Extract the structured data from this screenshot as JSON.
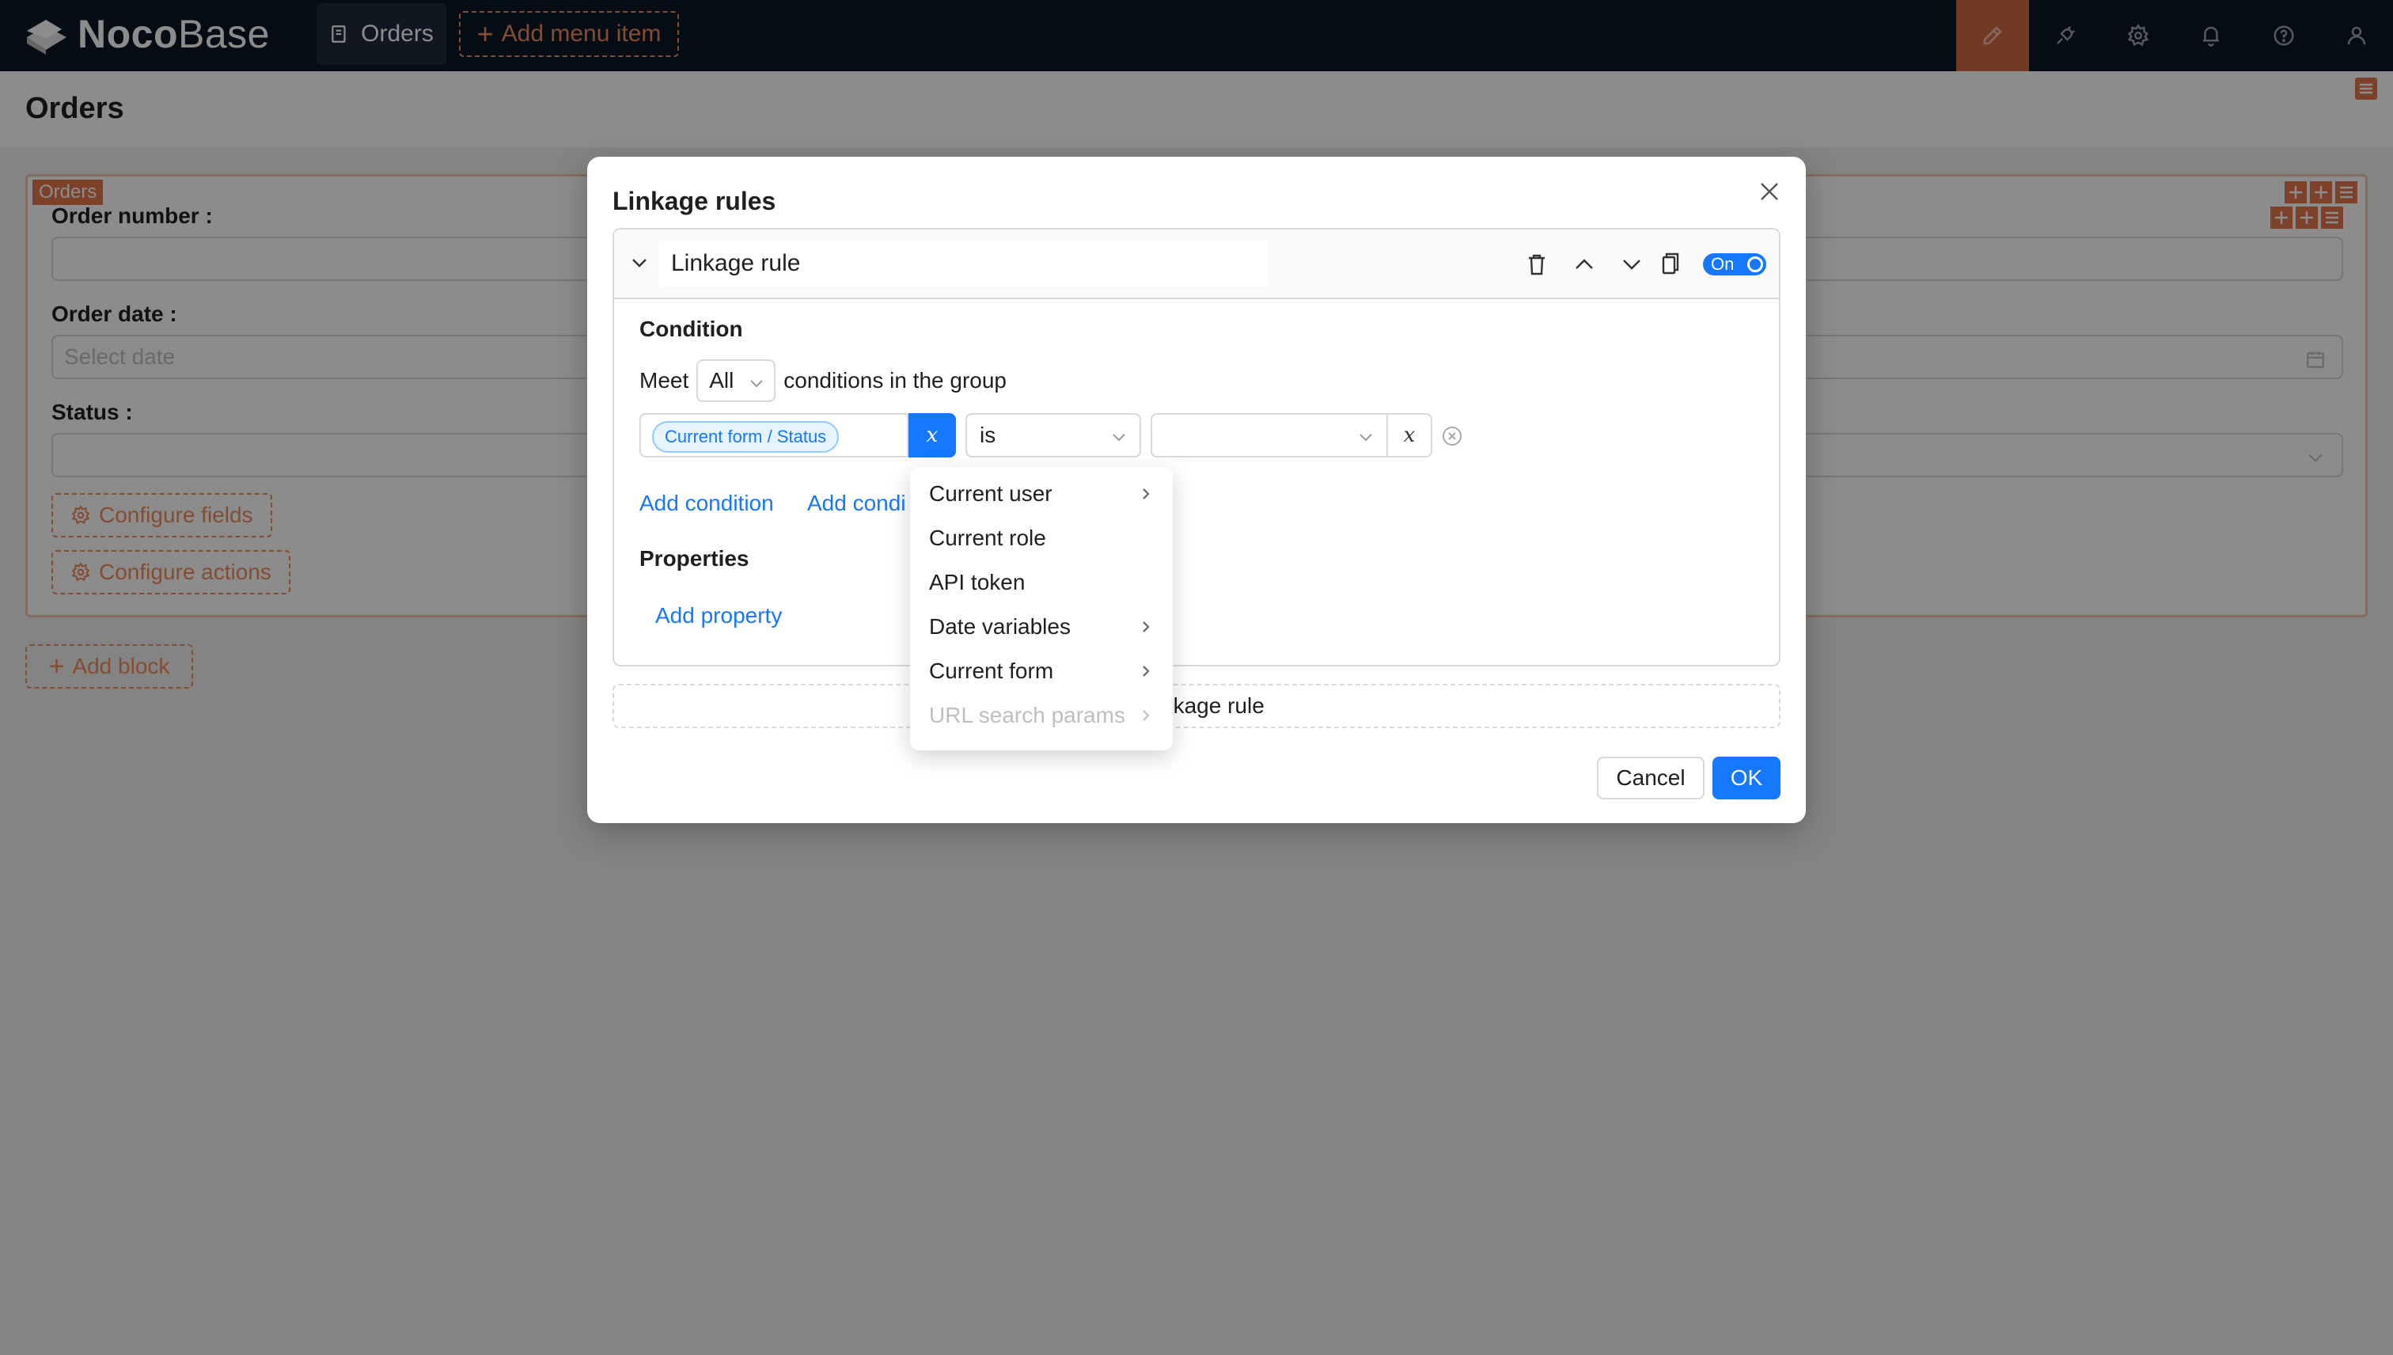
{
  "app": {
    "logo_text_bold": "Noco",
    "logo_text_light": "Base",
    "nav_menu": [
      "Orders"
    ],
    "add_menu_item_label": "Add menu item",
    "accent_color": "#f08a5d"
  },
  "page": {
    "title": "Orders",
    "block_tag": "Orders",
    "fields": [
      {
        "label": "Order number",
        "placeholder": ""
      },
      {
        "label": "Order date",
        "placeholder": "Select date"
      },
      {
        "label": "Status",
        "placeholder": ""
      }
    ],
    "configure_fields_label": "Configure fields",
    "configure_actions_label": "Configure actions",
    "add_block_label": "Add block"
  },
  "modal": {
    "title": "Linkage rules",
    "rule": {
      "name": "Linkage rule",
      "toggle_label": "On",
      "condition_heading": "Condition",
      "meet_prefix": "Meet",
      "meet_value": "All",
      "meet_suffix": "conditions in the group",
      "condition": {
        "field_tag": "Current form / Status",
        "var_symbol": "x",
        "operator": "is",
        "value": "",
        "value_var_symbol": "x"
      },
      "add_condition_label": "Add condition",
      "add_condition_group_label": "Add condi",
      "properties_heading": "Properties",
      "add_property_label": "Add property"
    },
    "add_rule_label": "linkage rule",
    "cancel_label": "Cancel",
    "ok_label": "OK"
  },
  "variable_menu": {
    "items": [
      {
        "label": "Current user",
        "has_children": true,
        "disabled": false
      },
      {
        "label": "Current role",
        "has_children": false,
        "disabled": false
      },
      {
        "label": "API token",
        "has_children": false,
        "disabled": false
      },
      {
        "label": "Date variables",
        "has_children": true,
        "disabled": false
      },
      {
        "label": "Current form",
        "has_children": true,
        "disabled": false
      },
      {
        "label": "URL search params",
        "has_children": true,
        "disabled": true
      }
    ]
  }
}
